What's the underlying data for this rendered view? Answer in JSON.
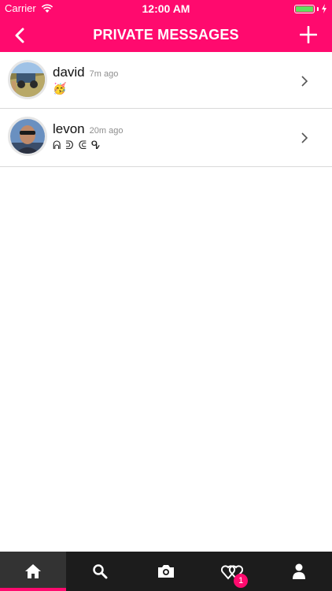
{
  "colors": {
    "accent": "#ff0a6e",
    "tabbar_bg": "#1c1c1c",
    "tab_active_bg": "#333333"
  },
  "status_bar": {
    "carrier": "Carrier",
    "time": "12:00 AM"
  },
  "nav": {
    "title": "PRIVATE MESSAGES",
    "back_icon": "chevron-left-icon",
    "add_icon": "plus-icon"
  },
  "messages": [
    {
      "name": "david",
      "time_ago": "7m ago",
      "preview": "🥳"
    },
    {
      "name": "levon",
      "time_ago": "20m ago",
      "preview": "ᕱ ᕲ ᕳ ᕴ"
    }
  ],
  "tabbar": {
    "tabs": [
      {
        "icon": "home-icon",
        "active": true
      },
      {
        "icon": "search-icon",
        "active": false
      },
      {
        "icon": "camera-icon",
        "active": false
      },
      {
        "icon": "hearts-icon",
        "active": false,
        "badge": "1"
      },
      {
        "icon": "profile-icon",
        "active": false
      }
    ]
  }
}
